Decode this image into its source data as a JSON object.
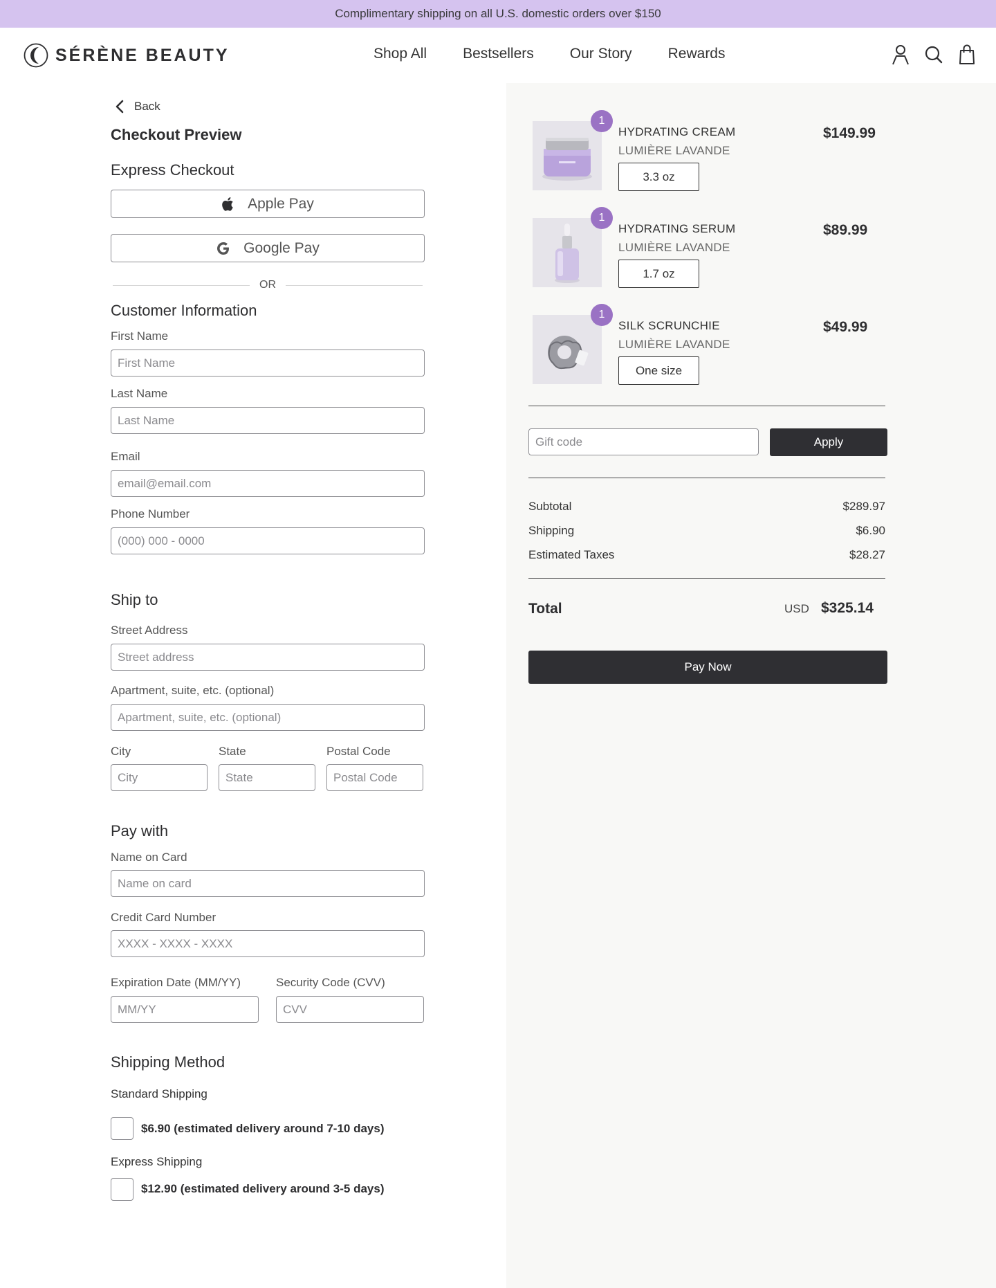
{
  "promo": {
    "text": "Complimentary shipping on all U.S. domestic orders over $150"
  },
  "brand": {
    "name": "SÉRÈNE BEAUTY",
    "icon": "crescent-moon-logo"
  },
  "nav": {
    "items": [
      "Shop All",
      "Bestsellers",
      "Our Story",
      "Rewards"
    ]
  },
  "header_icons": [
    "account-icon",
    "search-icon",
    "shopping-bag-icon"
  ],
  "checkout": {
    "back_label": "Back",
    "title": "Checkout Preview",
    "express_title": "Express Checkout",
    "apple_pay": "Apple Pay",
    "google_pay": "Google Pay",
    "or": "OR"
  },
  "customer": {
    "title": "Customer Information",
    "first_name": {
      "label": "First Name",
      "placeholder": "First Name"
    },
    "last_name": {
      "label": "Last Name",
      "placeholder": "Last Name"
    },
    "email": {
      "label": "Email",
      "placeholder": "email@email.com"
    },
    "phone": {
      "label": "Phone Number",
      "placeholder": "(000) 000 - 0000"
    }
  },
  "ship_to": {
    "title": "Ship to",
    "street": {
      "label": "Street Address",
      "placeholder": "Street address"
    },
    "apt": {
      "label": "Apartment, suite, etc. (optional)",
      "placeholder": "Apartment, suite, etc. (optional)"
    },
    "city": {
      "label": "City",
      "placeholder": "City"
    },
    "state": {
      "label": "State",
      "placeholder": "State"
    },
    "postal": {
      "label": "Postal Code",
      "placeholder": "Postal Code"
    }
  },
  "pay_with": {
    "title": "Pay with",
    "name_on_card": {
      "label": "Name on Card",
      "placeholder": "Name on card"
    },
    "card_number": {
      "label": "Credit Card Number",
      "placeholder": "XXXX - XXXX - XXXX"
    },
    "expiration": {
      "label": "Expiration Date (MM/YY)",
      "placeholder": "MM/YY"
    },
    "cvv": {
      "label": "Security Code (CVV)",
      "placeholder": "CVV"
    }
  },
  "shipping_method": {
    "title": "Shipping Method",
    "standard": {
      "label": "Standard Shipping",
      "option": "$6.90 (estimated delivery around 7-10 days)",
      "checked": false
    },
    "express": {
      "label": "Express Shipping",
      "option": "$12.90 (estimated delivery around 3-5 days)",
      "checked": false
    }
  },
  "cart": {
    "items": [
      {
        "qty": "1",
        "name": "HYDRATING CREAM",
        "brand": "LUMIÈRE LAVANDE",
        "size": "3.3 oz",
        "price": "$149.99",
        "image": "lavender-cream-jar"
      },
      {
        "qty": "1",
        "name": "HYDRATING SERUM",
        "brand": "LUMIÈRE LAVANDE",
        "size": "1.7 oz",
        "price": "$89.99",
        "image": "dropper-serum-bottle"
      },
      {
        "qty": "1",
        "name": "SILK SCRUNCHIE",
        "brand": "LUMIÈRE LAVANDE",
        "size": "One size",
        "price": "$49.99",
        "image": "silver-silk-scrunchie"
      }
    ],
    "gift_placeholder": "Gift code",
    "apply_label": "Apply"
  },
  "summary": {
    "subtotal_label": "Subtotal",
    "subtotal": "$289.97",
    "shipping_label": "Shipping",
    "shipping": "$6.90",
    "taxes_label": "Estimated Taxes",
    "taxes": "$28.27",
    "total_label": "Total",
    "currency": "USD",
    "total": "$325.14",
    "pay_now": "Pay Now"
  },
  "colors": {
    "promo_bg": "#d5c3ef",
    "badge": "#9a72c4",
    "dark_button": "#2f2f33",
    "panel_bg": "#f8f8f6"
  }
}
